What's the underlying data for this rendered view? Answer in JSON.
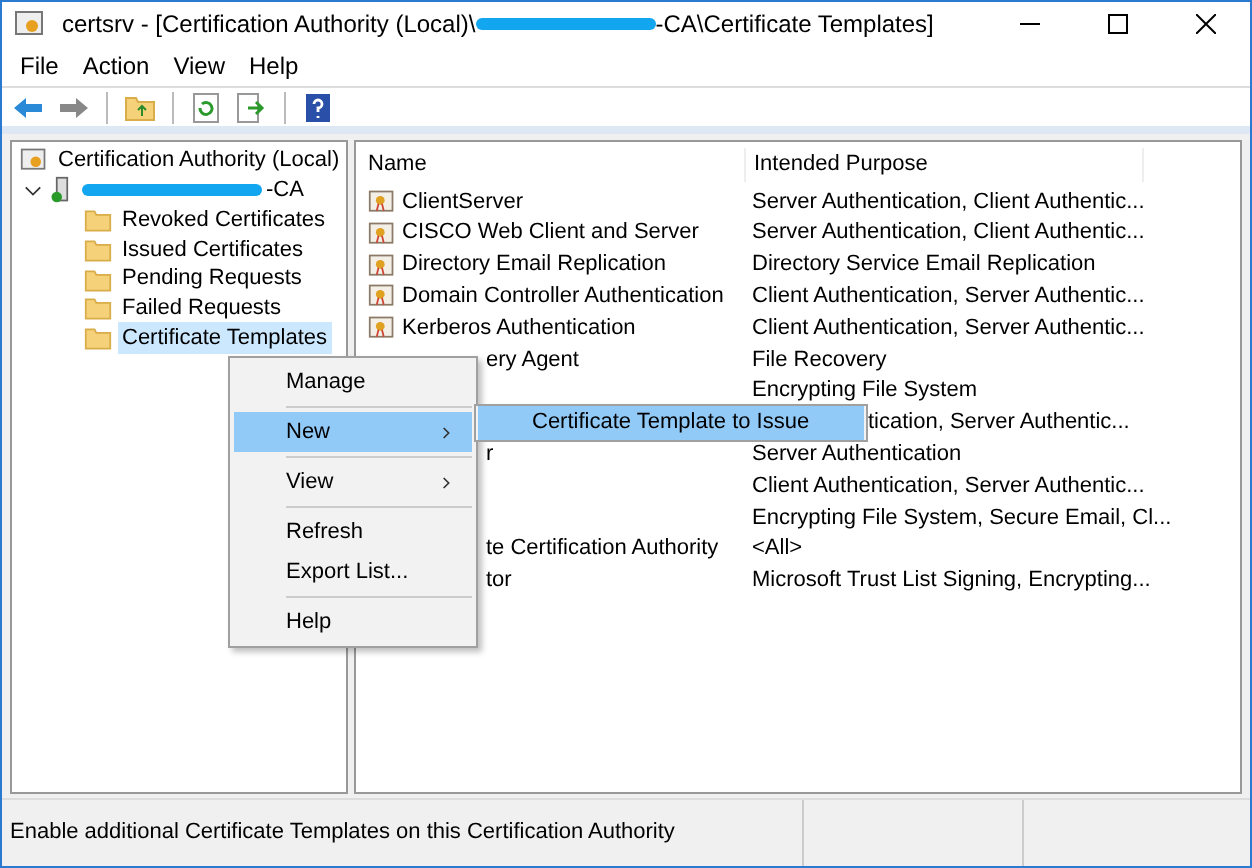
{
  "window": {
    "title_before": "certsrv - [Certification Authority (Local)\\",
    "title_after": "-CA\\Certificate Templates]"
  },
  "menu_bar": [
    "File",
    "Action",
    "View",
    "Help"
  ],
  "tree": {
    "label": "Certification Authority (Local)",
    "children": [
      {
        "label": "-CA",
        "expanded": true,
        "children": [
          {
            "label": "Revoked Certificates",
            "selected": false
          },
          {
            "label": "Issued Certificates",
            "selected": false
          },
          {
            "label": "Pending Requests",
            "selected": false
          },
          {
            "label": "Failed Requests",
            "selected": false
          },
          {
            "label": "Certificate Templates",
            "selected": true
          }
        ]
      }
    ]
  },
  "table": {
    "columns": [
      "Name",
      "Intended Purpose"
    ],
    "rows": [
      {
        "kind": "full",
        "name": "ClientServer",
        "purpose": "Server Authentication, Client Authentic..."
      },
      {
        "kind": "full",
        "name": "CISCO  Web Client and Server",
        "purpose": "Server Authentication, Client Authentic..."
      },
      {
        "kind": "full",
        "name": "Directory Email Replication",
        "purpose": "Directory Service Email Replication"
      },
      {
        "kind": "full",
        "name": "Domain Controller Authentication",
        "purpose": "Client Authentication, Server Authentic..."
      },
      {
        "kind": "full",
        "name": "Kerberos Authentication",
        "purpose": "Client Authentication, Server Authentic..."
      },
      {
        "kind": "cut",
        "name": "ery Agent",
        "purpose": "File Recovery"
      },
      {
        "kind": "cut",
        "purpose": "Encrypting File System"
      },
      {
        "kind": "cut",
        "purpose_cut": "tication, Server Authentic..."
      },
      {
        "kind": "cut",
        "name": "r",
        "purpose": "Server Authentication"
      },
      {
        "kind": "cut",
        "purpose": "Client Authentication, Server Authentic..."
      },
      {
        "kind": "cut",
        "purpose": "Encrypting File System, Secure Email, Cl..."
      },
      {
        "kind": "cut",
        "name": "te Certification Authority",
        "purpose": "<All>"
      },
      {
        "kind": "cut",
        "name": "tor",
        "purpose": "Microsoft Trust List Signing, Encrypting..."
      }
    ]
  },
  "context_menu": [
    {
      "kind": "item",
      "label": "Manage",
      "selected": false,
      "submenu": false
    },
    {
      "kind": "separator"
    },
    {
      "kind": "item",
      "label": "New",
      "selected": true,
      "submenu": true
    },
    {
      "kind": "separator"
    },
    {
      "kind": "item",
      "label": "View",
      "selected": false,
      "submenu": true
    },
    {
      "kind": "separator"
    },
    {
      "kind": "item",
      "label": "Refresh",
      "selected": false,
      "submenu": false
    },
    {
      "kind": "item",
      "label": "Export List...",
      "selected": false,
      "submenu": false
    },
    {
      "kind": "separator"
    },
    {
      "kind": "item",
      "label": "Help",
      "selected": false,
      "submenu": false
    }
  ],
  "submenu": [
    {
      "label": "Certificate Template to Issue",
      "selected": true
    }
  ],
  "status_bar": "Enable additional Certificate Templates on this Certification Authority"
}
